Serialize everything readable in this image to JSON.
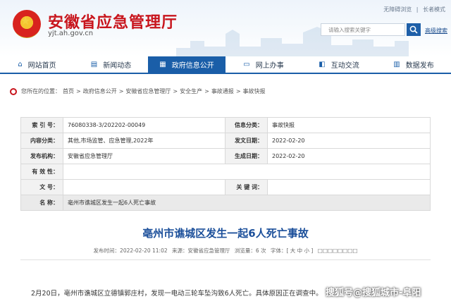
{
  "header": {
    "site_title": "安徽省应急管理厅",
    "site_domain": "yjt.ah.gov.cn",
    "top_links": [
      "无障碍浏览",
      "|",
      "长者模式"
    ],
    "search_placeholder": "请输入搜索关键字",
    "advanced_search": "高级搜索"
  },
  "nav": {
    "items": [
      {
        "label": "网站首页",
        "icon": "home-icon"
      },
      {
        "label": "新闻动态",
        "icon": "news-icon"
      },
      {
        "label": "政府信息公开",
        "icon": "document-icon",
        "active": true
      },
      {
        "label": "网上办事",
        "icon": "monitor-icon"
      },
      {
        "label": "互动交流",
        "icon": "chat-icon"
      },
      {
        "label": "数据发布",
        "icon": "chart-icon"
      }
    ]
  },
  "breadcrumb": {
    "prefix": "您所在的位置：",
    "items": [
      "首页",
      "政府信息公开",
      "安徽省应急管理厅",
      "安全生产",
      "事故通报",
      "事故快报"
    ],
    "separator": ">"
  },
  "info": {
    "index_label": "索 引 号：",
    "index_value": "76080338-3/202202-00049",
    "category_label": "信息分类：",
    "category_value": "事故快报",
    "content_label": "内容分类：",
    "content_value": "其他,市场监管、应急管理,2022年",
    "pub_date_label": "发文日期：",
    "pub_date_value": "2022-02-20",
    "org_label": "发布机构：",
    "org_value": "安徽省应急管理厅",
    "effective_label": "生成日期：",
    "effective_value": "2022-02-20",
    "validity_label": "有 效 性：",
    "validity_value": "",
    "doc_no_label": "文    号：",
    "doc_no_value": "",
    "keywords_label": "关 键 词：",
    "keywords_value": "",
    "name_label": "名    称：",
    "name_value": "亳州市谯城区发生一起6人死亡事故"
  },
  "article": {
    "title": "亳州市谯城区发生一起6人死亡事故",
    "meta_date": "发布时间：2022-02-20 11:02",
    "meta_source": "来源：安徽省应急管理厅",
    "meta_views": "浏览量：6 次",
    "meta_font": "字体：[ 大 中 小 ]",
    "meta_tools": "□□□□□□□□",
    "body": "2月20日，亳州市谯城区立德镇郭庄村，发现一电动三轮车坠沟致6人死亡。具体原因正在调查中。"
  },
  "watermark": "搜狐号@搜狐城市-阜阳"
}
